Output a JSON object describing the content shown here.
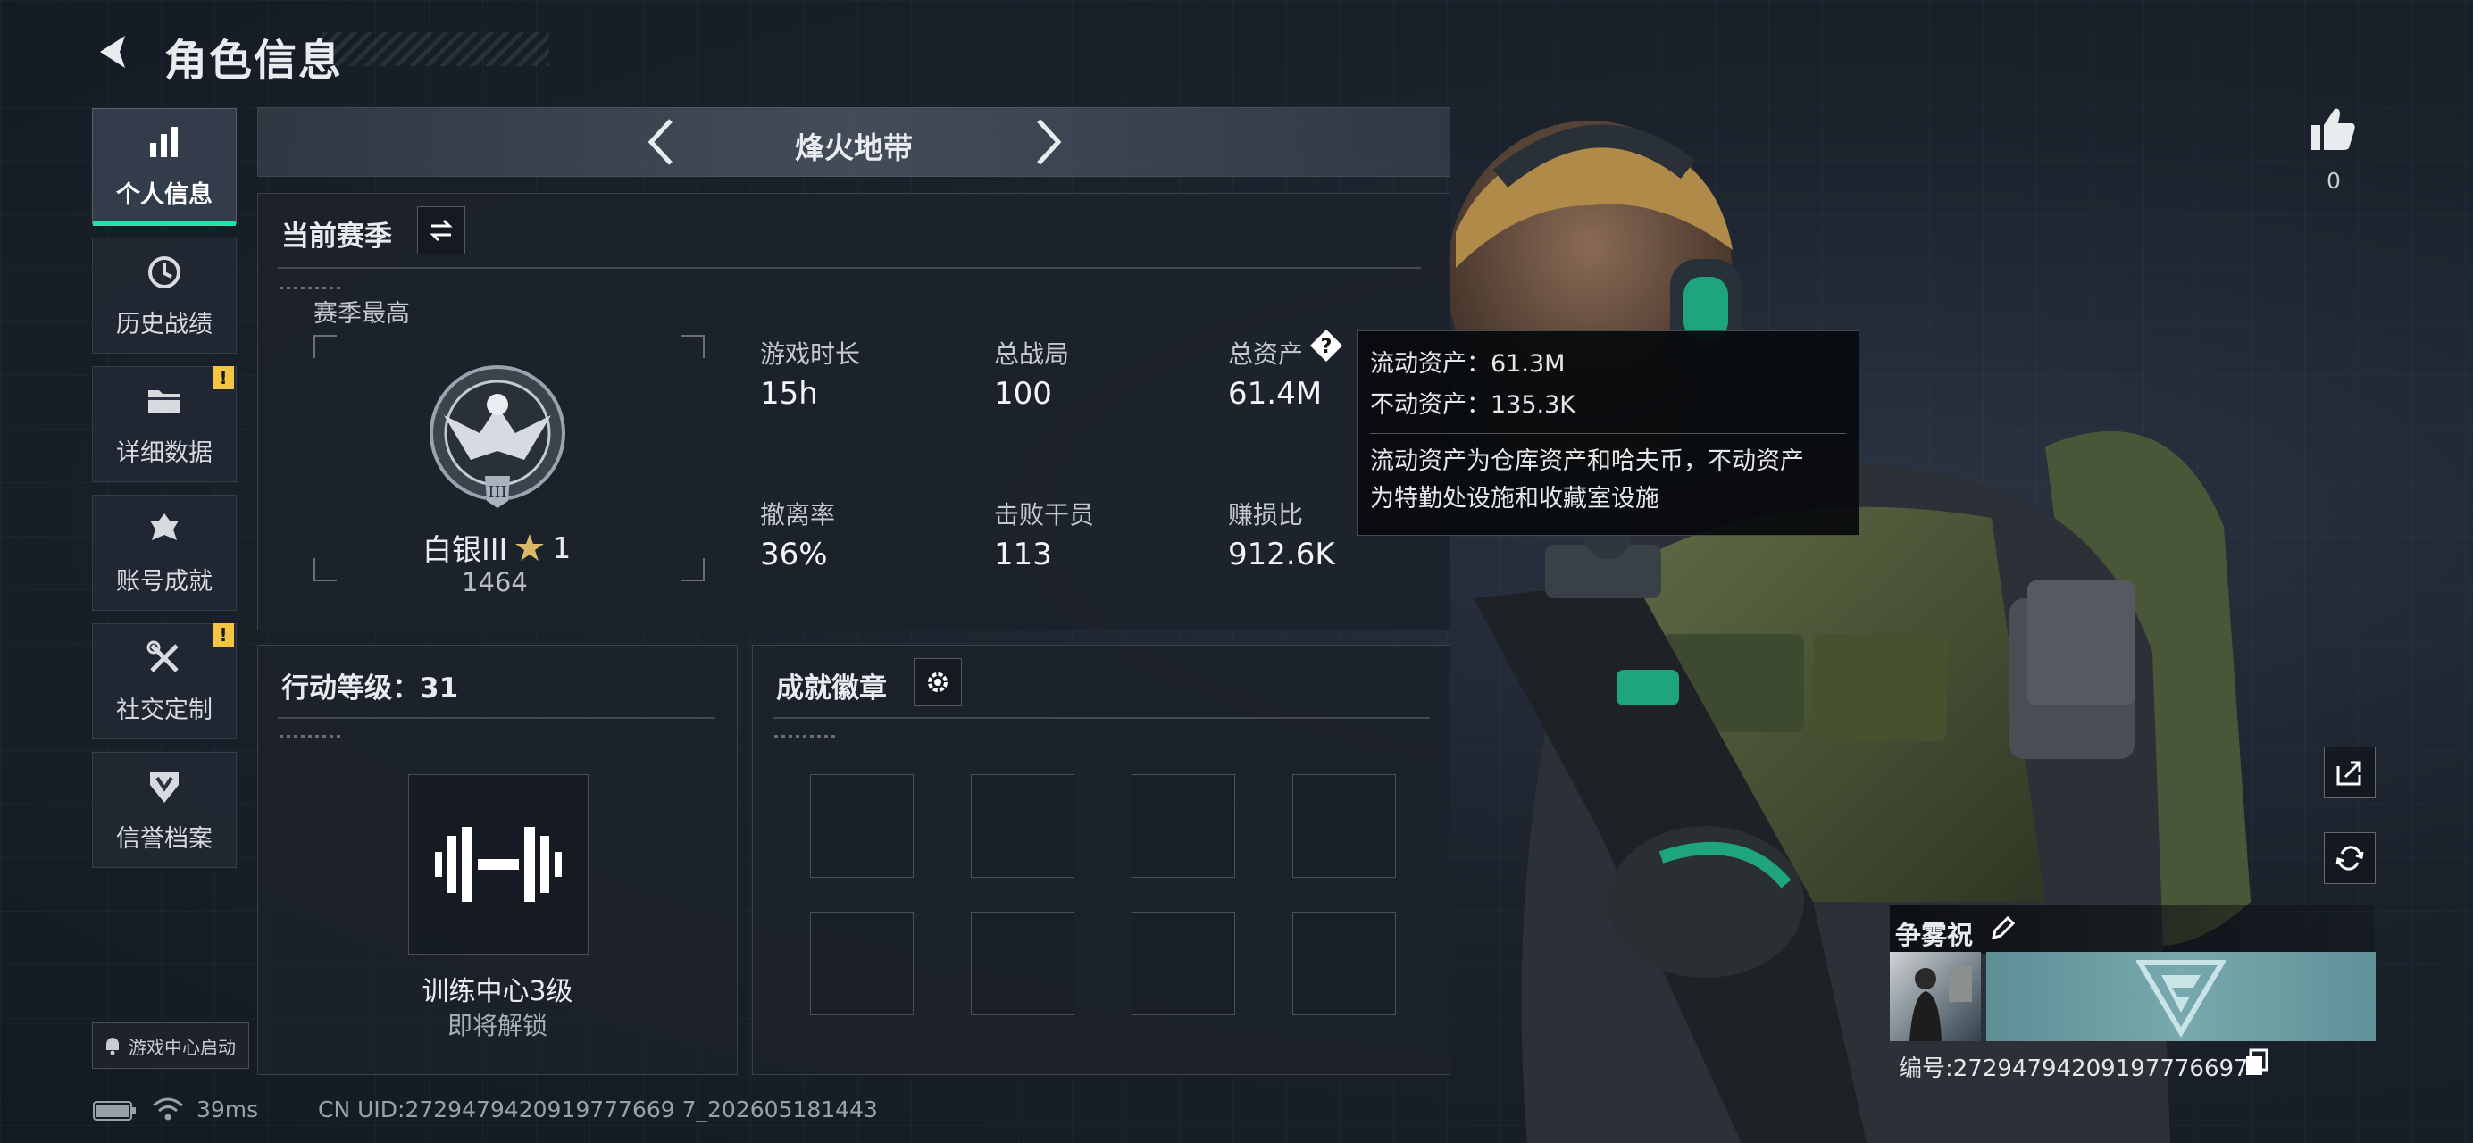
{
  "header": {
    "title": "角色信息"
  },
  "sidebar": {
    "items": [
      {
        "label": "个人信息",
        "icon": "bar-chart-icon",
        "active": true
      },
      {
        "label": "历史战绩",
        "icon": "history-icon",
        "warning": false
      },
      {
        "label": "详细数据",
        "icon": "folder-icon",
        "warning": true
      },
      {
        "label": "账号成就",
        "icon": "achievement-icon",
        "warning": false
      },
      {
        "label": "社交定制",
        "icon": "tools-icon",
        "warning": true
      },
      {
        "label": "信誉档案",
        "icon": "shield-icon",
        "warning": false
      }
    ],
    "warning_glyph": "!",
    "launch_label": "游戏中心启动"
  },
  "mode": {
    "title": "烽火地带"
  },
  "season": {
    "title": "当前赛季",
    "best_label": "赛季最高",
    "rank_name": "白银III",
    "rank_stars": "1",
    "rank_score": "1464",
    "stats": [
      {
        "label": "游戏时长",
        "value": "15h"
      },
      {
        "label": "总战局",
        "value": "100"
      },
      {
        "label": "总资产",
        "value": "61.4M"
      },
      {
        "label": "撤离率",
        "value": "36%"
      },
      {
        "label": "击败干员",
        "value": "113"
      },
      {
        "label": "赚损比",
        "value": "912.6K"
      }
    ],
    "help_glyph": "?"
  },
  "tooltip": {
    "liquid": "流动资产：61.3M",
    "fixed": "不动资产：135.3K",
    "desc_1": "流动资产为仓库资产和哈夫币，不动资产",
    "desc_2": "为特勤处设施和收藏室设施"
  },
  "level": {
    "title": "行动等级：31",
    "training_title": "训练中心3级",
    "training_status": "即将解锁"
  },
  "badges": {
    "title": "成就徽章",
    "slot_count": 8
  },
  "footer": {
    "ping": "39ms",
    "uid": "CN UID:2729479420919777669 7_202605181443"
  },
  "right": {
    "like_count": "0",
    "player_name": "争雾祝",
    "player_id": "编号:27294794209197776697"
  },
  "colors": {
    "accent": "#29e0a6",
    "warning": "#f3c542",
    "background": "#1b222c"
  }
}
